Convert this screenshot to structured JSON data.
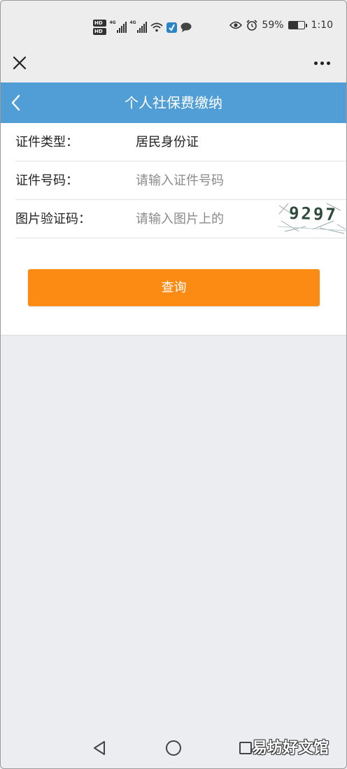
{
  "status_bar": {
    "hd_label": "HD",
    "hd_sub": "B",
    "network_1": "4G",
    "network_2": "4G",
    "battery_percent": "59%",
    "battery_level": 0.59,
    "time": "1:10",
    "icons": [
      "signal-icon",
      "wifi-icon",
      "app-notification-icon",
      "chat-bubble-icon",
      "eye-icon",
      "alarm-icon",
      "battery-icon"
    ]
  },
  "top_bar": {
    "close_icon": "close-icon",
    "more_icon": "more-dots-icon"
  },
  "header": {
    "title": "个人社保费缴纳",
    "back_icon": "chevron-left-icon",
    "color": "#519ed7"
  },
  "form": {
    "id_type": {
      "label": "证件类型：",
      "value": "居民身份证"
    },
    "id_number": {
      "label": "证件号码：",
      "placeholder": "请输入证件号码"
    },
    "captcha": {
      "label": "图片验证码：",
      "placeholder": "请输入图片上的",
      "image_text": "9297"
    },
    "query_button": {
      "label": "查询",
      "color": "#fb8b13"
    }
  },
  "nav_bar": {
    "icons": [
      "nav-back-icon",
      "nav-home-icon",
      "nav-recent-icon"
    ]
  },
  "watermark": "易坊好文馆"
}
